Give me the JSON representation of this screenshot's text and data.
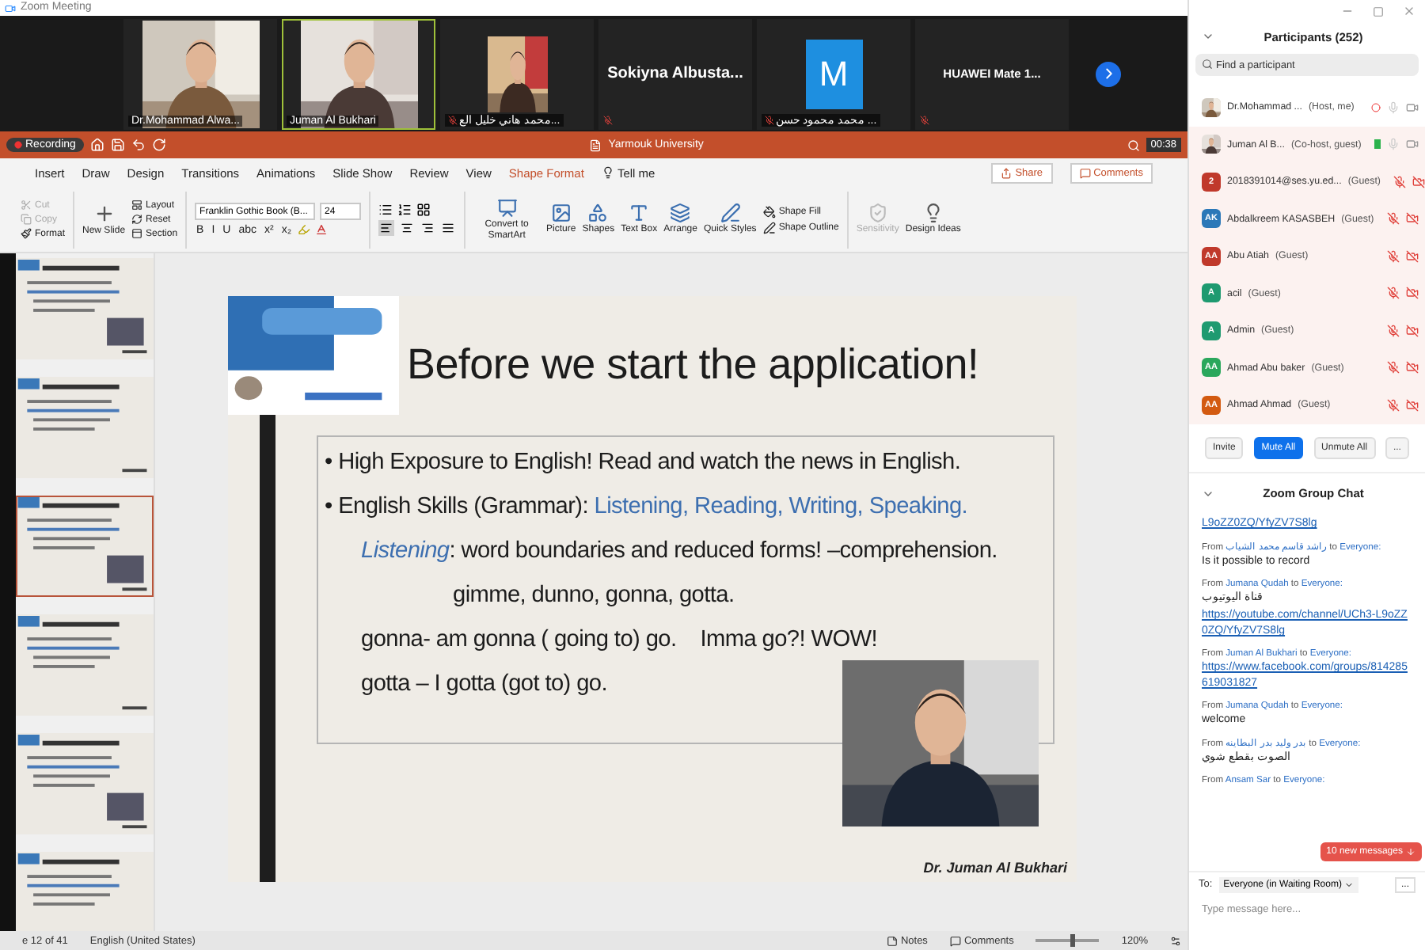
{
  "app_title": "Zoom Meeting",
  "video_tiles": [
    {
      "kind": "video",
      "name": "Dr.Mohammad Alwa...",
      "muted": false,
      "active": false
    },
    {
      "kind": "video",
      "name": "Juman Al Bukhari",
      "muted": false,
      "active": true
    },
    {
      "kind": "portrait",
      "name": "محمد هاني خليل الع...",
      "muted": true,
      "active": false
    },
    {
      "kind": "name",
      "name": "Sokiyna  Albusta...",
      "muted": true,
      "active": false
    },
    {
      "kind": "avatar",
      "letter": "M",
      "name": "محمد محمود حسن ...",
      "muted": true,
      "active": false
    },
    {
      "kind": "device",
      "name": "HUAWEI Mate 1...",
      "muted": true,
      "active": false
    }
  ],
  "presentation": {
    "recording": "Recording",
    "file": "Yarmouk University",
    "timer": "00:38",
    "tabs": [
      {
        "label": "Insert",
        "selected": false
      },
      {
        "label": "Draw",
        "selected": false
      },
      {
        "label": "Design",
        "selected": false
      },
      {
        "label": "Transitions",
        "selected": false
      },
      {
        "label": "Animations",
        "selected": false
      },
      {
        "label": "Slide Show",
        "selected": false
      },
      {
        "label": "Review",
        "selected": false
      },
      {
        "label": "View",
        "selected": false
      },
      {
        "label": "Shape Format",
        "selected": true
      }
    ],
    "tell_me": "Tell me",
    "share": "Share",
    "comments": "Comments",
    "clipboard": [
      {
        "label": "Cut",
        "disabled": true
      },
      {
        "label": "Copy",
        "disabled": true
      },
      {
        "label": "Format",
        "disabled": false
      }
    ],
    "new_slide": "New Slide",
    "slide_tools": [
      {
        "label": "Layout"
      },
      {
        "label": "Reset"
      },
      {
        "label": "Section"
      }
    ],
    "font": "Franklin Gothic Book (B...",
    "font_size": "24",
    "format_buttons": [
      "B",
      "I",
      "U",
      "abc",
      "x²",
      "x₂"
    ],
    "align": [
      {
        "selected": true
      },
      {
        "selected": false
      },
      {
        "selected": false
      },
      {
        "selected": false
      }
    ],
    "large_buttons": [
      {
        "label": "Convert to SmartArt",
        "disabled": false
      },
      {
        "label": "Picture",
        "disabled": false
      },
      {
        "label": "Shapes",
        "disabled": false
      },
      {
        "label": "Text Box",
        "disabled": false
      },
      {
        "label": "Arrange",
        "disabled": false
      },
      {
        "label": "Quick Styles",
        "disabled": false
      }
    ],
    "shape_tools": [
      {
        "label": "Shape Fill"
      },
      {
        "label": "Shape Outline"
      }
    ],
    "end_buttons": [
      {
        "label": "Sensitivity",
        "disabled": true
      },
      {
        "label": "Design Ideas",
        "disabled": false
      }
    ],
    "thumbnails": [
      {
        "selected": false
      },
      {
        "selected": false
      },
      {
        "selected": true
      },
      {
        "selected": false
      },
      {
        "selected": false
      },
      {
        "selected": false
      }
    ],
    "slide": {
      "title": "Before we start the application!",
      "lines": [
        {
          "kind": "bullet",
          "marker": "•",
          "parts": [
            {
              "text": "High Exposure to English! Read and watch the news in English.",
              "accent": false
            }
          ]
        },
        {
          "kind": "bullet",
          "marker": "•",
          "parts": [
            {
              "text": "English Skills (Grammar): ",
              "accent": false
            },
            {
              "text": "Listening, Reading, Writing, Speaking.",
              "accent": true
            }
          ]
        },
        {
          "kind": "indent",
          "parts": [
            {
              "text": "Listening",
              "accent": true
            },
            {
              "text": ": word boundaries and reduced forms! –comprehension.",
              "accent": false
            }
          ]
        },
        {
          "kind": "deep",
          "parts": [
            {
              "text": "gimme, dunno, gonna, gotta.",
              "accent": false
            }
          ]
        },
        {
          "kind": "indent",
          "parts": [
            {
              "text": "gonna- am gonna ( going to) go.    Imma go?! WOW!",
              "accent": false
            }
          ]
        },
        {
          "kind": "indent",
          "parts": [
            {
              "text": "gotta – I gotta (got to) go.",
              "accent": false
            }
          ]
        }
      ],
      "footer": "Dr. Juman Al Bukhari"
    },
    "status": {
      "slide_counter": "e 12 of 41",
      "language": "English (United States)",
      "notes": "Notes",
      "comments": "Comments",
      "zoom": "120%",
      "zoom_slider": {
        "level": 0.55
      }
    }
  },
  "participants": {
    "title": "Participants (252)",
    "search": {
      "placeholder": "Find a participant"
    },
    "list": [
      {
        "kind": "host",
        "name": "Dr.Mohammad ...",
        "role": "(Host, me)",
        "muted": false,
        "video_on": true
      },
      {
        "kind": "cohost",
        "name": "Juman Al B...",
        "role": "(Co-host, guest)",
        "muted": false,
        "video_on": true
      },
      {
        "kind": "guest",
        "initials": "2",
        "color": "#c0392b",
        "name": "2018391014@ses.yu.ed...",
        "role": "(Guest)",
        "muted": true,
        "video_on": false
      },
      {
        "kind": "guest",
        "initials": "AK",
        "color": "#2b78b8",
        "name": "Abdalkreem KASASBEH",
        "role": "(Guest)",
        "muted": true,
        "video_on": false
      },
      {
        "kind": "guest",
        "initials": "AA",
        "color": "#c0392b",
        "name": "Abu Atiah",
        "role": "(Guest)",
        "muted": true,
        "video_on": false
      },
      {
        "kind": "guest",
        "initials": "A",
        "color": "#1e9a70",
        "name": "acil",
        "role": "(Guest)",
        "muted": true,
        "video_on": false
      },
      {
        "kind": "guest",
        "initials": "A",
        "color": "#1e9a70",
        "name": "Admin",
        "role": "(Guest)",
        "muted": true,
        "video_on": false
      },
      {
        "kind": "guest",
        "initials": "AA",
        "color": "#2aa75c",
        "name": "Ahmad Abu baker",
        "role": "(Guest)",
        "muted": true,
        "video_on": false
      },
      {
        "kind": "guest",
        "initials": "AA",
        "color": "#d35a10",
        "name": "Ahmad Ahmad",
        "role": "(Guest)",
        "muted": true,
        "video_on": false
      }
    ],
    "buttons": [
      {
        "label": "Invite",
        "kind": "plain"
      },
      {
        "label": "Mute All",
        "kind": "primary"
      },
      {
        "label": "Unmute All",
        "kind": "plain"
      },
      {
        "label": "...",
        "kind": "plain"
      }
    ]
  },
  "chat": {
    "title": "Zoom Group Chat",
    "messages": [
      {
        "body": [
          {
            "text": "L9oZZ0ZQ/YfyZV7S8lg",
            "link": true
          }
        ]
      },
      {
        "prefix": "From",
        "from": "راشد قاسم محمد الشياب",
        "joiner": "to",
        "to": "Everyone:",
        "body": [
          {
            "text": "Is it possible to record",
            "link": false
          }
        ]
      },
      {
        "prefix": "From",
        "from": "Jumana Qudah",
        "joiner": "to",
        "to": "Everyone:",
        "body": [
          {
            "text": "قناة اليوتيوب",
            "link": false
          },
          {
            "text": "https://youtube.com/channel/UCh3-L9oZZ0ZQ/YfyZV7S8lg",
            "link": true
          }
        ]
      },
      {
        "prefix": "From",
        "from": "Juman Al Bukhari",
        "joiner": "to",
        "to": "Everyone:",
        "body": [
          {
            "text": "https://www.facebook.com/groups/814285619031827",
            "link": true
          }
        ]
      },
      {
        "prefix": "From",
        "from": "Jumana Qudah",
        "joiner": "to",
        "to": "Everyone:",
        "body": [
          {
            "text": "welcome",
            "link": false
          }
        ]
      },
      {
        "prefix": "From",
        "from": "بدر وليد بدر البطاينه",
        "joiner": "to",
        "to": "Everyone:",
        "body": [
          {
            "text": "الصوت بقطع شوي",
            "link": false
          }
        ]
      },
      {
        "prefix": "From",
        "from": "Ansam Sar",
        "joiner": "to",
        "to": "Everyone:"
      }
    ],
    "new_messages": "10 new messages",
    "to_label": "To:",
    "recipient": "Everyone (in Waiting Room)",
    "more": "...",
    "input": {
      "placeholder": "Type message here..."
    }
  }
}
